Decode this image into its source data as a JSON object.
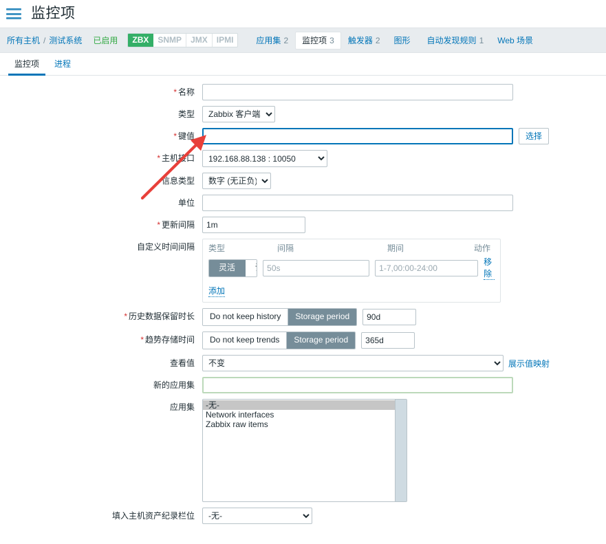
{
  "header": {
    "menu_icon": "hamburger-icon",
    "title": "监控项"
  },
  "breadcrumb": {
    "all_hosts": "所有主机",
    "separator": "/",
    "host": "测试系统",
    "status": "已启用",
    "protocols": [
      {
        "label": "ZBX",
        "enabled": true
      },
      {
        "label": "SNMP",
        "enabled": false
      },
      {
        "label": "JMX",
        "enabled": false
      },
      {
        "label": "IPMI",
        "enabled": false
      }
    ],
    "tabs": [
      {
        "label": "应用集",
        "count": "2",
        "active": false
      },
      {
        "label": "监控项",
        "count": "3",
        "active": true
      },
      {
        "label": "触发器",
        "count": "2",
        "active": false
      },
      {
        "label": "图形",
        "count": "",
        "active": false
      },
      {
        "label": "自动发现规则",
        "count": "1",
        "active": false
      },
      {
        "label": "Web 场景",
        "count": "",
        "active": false
      }
    ]
  },
  "subtabs": [
    {
      "label": "监控项",
      "active": true
    },
    {
      "label": "进程",
      "active": false
    }
  ],
  "form": {
    "name": {
      "label": "名称",
      "required": true,
      "value": "",
      "placeholder": ""
    },
    "type": {
      "label": "类型",
      "required": false,
      "value": "Zabbix 客户端"
    },
    "key": {
      "label": "键值",
      "required": true,
      "value": "",
      "placeholder": "",
      "button": "选择",
      "focused": true
    },
    "host_interface": {
      "label": "主机接口",
      "required": true,
      "value": "192.168.88.138 : 10050"
    },
    "info_type": {
      "label": "信息类型",
      "required": false,
      "value": "数字 (无正负)"
    },
    "units": {
      "label": "单位",
      "required": false,
      "value": "",
      "placeholder": ""
    },
    "update_interval": {
      "label": "更新间隔",
      "required": true,
      "value": "1m"
    },
    "custom_intervals": {
      "label": "自定义时间间隔",
      "columns": [
        "类型",
        "间隔",
        "期间",
        "动作"
      ],
      "rows": [
        {
          "type_options": [
            "灵活",
            "调度"
          ],
          "type_selected": "灵活",
          "interval_value": "",
          "interval_placeholder": "50s",
          "period_value": "",
          "period_placeholder": "1-7,00:00-24:00",
          "action": "移除"
        }
      ],
      "add_label": "添加"
    },
    "history": {
      "label": "历史数据保留时长",
      "required": true,
      "options": [
        "Do not keep history",
        "Storage period"
      ],
      "selected": "Storage period",
      "value": "90d"
    },
    "trends": {
      "label": "趋势存储时间",
      "required": true,
      "options": [
        "Do not keep trends",
        "Storage period"
      ],
      "selected": "Storage period",
      "value": "365d"
    },
    "show_value": {
      "label": "查看值",
      "value": "不变",
      "link": "展示值映射"
    },
    "new_application": {
      "label": "新的应用集",
      "value": "",
      "placeholder": ""
    },
    "applications": {
      "label": "应用集",
      "options": [
        {
          "label": "-无-",
          "selected": true
        },
        {
          "label": "Network interfaces",
          "selected": false
        },
        {
          "label": "Zabbix raw items",
          "selected": false
        }
      ]
    },
    "inventory_field": {
      "label": "填入主机资产纪录栏位",
      "value": "-无-"
    }
  },
  "annotation": {
    "arrow_color": "#e8403a",
    "name": "red-arrow-pointing-to-key-field"
  },
  "colors": {
    "accent_blue": "#0275b8",
    "status_green": "#34aa44",
    "badge_green": "#34af67",
    "band_gray": "#e8ecef",
    "toggle_gray": "#768d99",
    "required_red": "#d42f2f"
  }
}
